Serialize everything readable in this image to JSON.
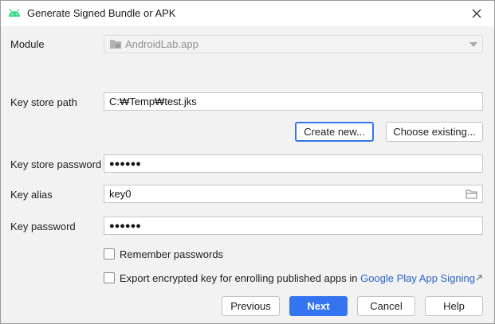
{
  "window": {
    "title": "Generate Signed Bundle or APK",
    "accent_color": "#3574f0",
    "android_green": "#3ddc84"
  },
  "module": {
    "label": "Module",
    "value": "AndroidLab.app"
  },
  "key_store_path": {
    "label": "Key store path",
    "value": "C:₩Temp₩test.jks"
  },
  "buttons": {
    "create_new": "Create new...",
    "choose_existing": "Choose existing...",
    "previous": "Previous",
    "next": "Next",
    "cancel": "Cancel",
    "help": "Help"
  },
  "key_store_password": {
    "label": "Key store password",
    "value": "●●●●●●"
  },
  "key_alias": {
    "label": "Key alias",
    "value": "key0"
  },
  "key_password": {
    "label": "Key password",
    "value": "●●●●●●"
  },
  "options": {
    "remember_passwords": "Remember passwords",
    "export_text": "Export encrypted key for enrolling published apps in",
    "export_link": "Google Play App Signing"
  }
}
